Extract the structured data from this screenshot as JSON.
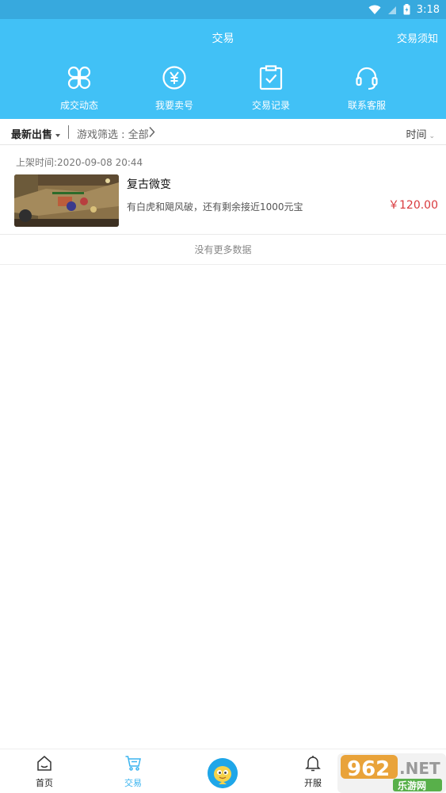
{
  "status_bar": {
    "time": "3:18"
  },
  "header": {
    "title": "交易",
    "notice_link": "交易须知"
  },
  "quick_nav": [
    {
      "label": "成交动态",
      "icon": "clover-icon"
    },
    {
      "label": "我要卖号",
      "icon": "yen-coin-icon"
    },
    {
      "label": "交易记录",
      "icon": "clipboard-check-icon"
    },
    {
      "label": "联系客服",
      "icon": "headset-icon"
    }
  ],
  "filter": {
    "sort_label": "最新出售",
    "game_filter_label": "游戏筛选 : 全部",
    "time_label": "时间"
  },
  "listings": [
    {
      "time": "上架时间:2020-09-08 20:44",
      "title": "复古微变",
      "description": "有白虎和飓风破，还有剩余接近1000元宝",
      "price": "￥120.00"
    }
  ],
  "no_more_text": "没有更多数据",
  "tab_bar": {
    "tabs": [
      {
        "label": "首页",
        "icon": "home-icon"
      },
      {
        "label": "交易",
        "icon": "cart-icon",
        "active": true
      },
      {
        "label": "",
        "icon": "mascot-icon"
      },
      {
        "label": "开服",
        "icon": "bell-icon"
      }
    ]
  },
  "watermark": {
    "text_main": "962.NET",
    "text_sub": "乐游网"
  },
  "colors": {
    "header_bg": "#41c1f6",
    "status_bg": "#37a9de",
    "price": "#d9393d",
    "active_tab": "#3ab4ef"
  }
}
